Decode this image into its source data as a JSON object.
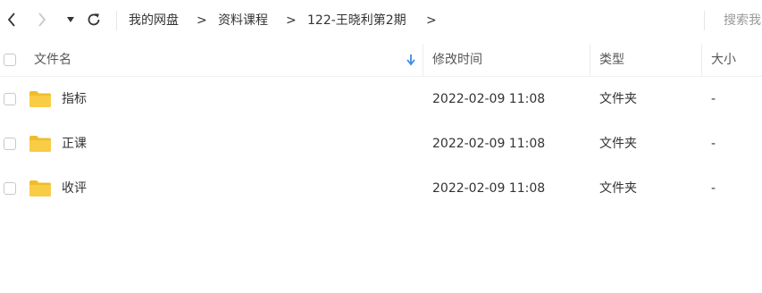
{
  "toolbar": {
    "back_glyph": "‹",
    "forward_glyph": "›",
    "dropdown_glyph": "▾",
    "refresh_glyph": "↻",
    "breadcrumb": [
      {
        "label": "我的网盘"
      },
      {
        "label": "资料课程"
      },
      {
        "label": "122-王晓利第2期"
      }
    ],
    "separator": ">",
    "search_placeholder": "搜索我"
  },
  "table": {
    "columns": {
      "name": "文件名",
      "modified": "修改时间",
      "type": "类型",
      "size": "大小"
    },
    "sort_icon": "arrow-down-icon",
    "rows": [
      {
        "name": "指标",
        "modified": "2022-02-09 11:08",
        "type": "文件夹",
        "size": "-"
      },
      {
        "name": "正课",
        "modified": "2022-02-09 11:08",
        "type": "文件夹",
        "size": "-"
      },
      {
        "name": "收评",
        "modified": "2022-02-09 11:08",
        "type": "文件夹",
        "size": "-"
      }
    ]
  },
  "colors": {
    "folder": "#f8cc45",
    "folder_dark": "#f0bd2a",
    "sort_arrow": "#3a8ee6",
    "disabled_arrow": "#c8c8c8"
  }
}
